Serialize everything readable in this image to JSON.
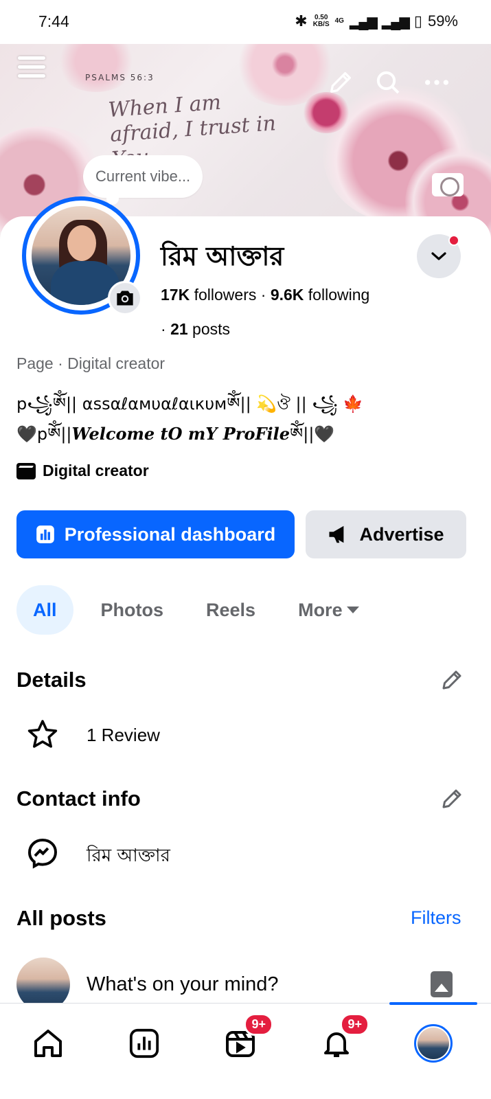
{
  "status": {
    "time": "7:44",
    "speed_value": "0.50",
    "speed_unit": "KB/S",
    "network": "4G",
    "battery": "59%"
  },
  "cover": {
    "verse": "PSALMS 56:3",
    "quote": "When I am afraid, I trust in You"
  },
  "vibe": {
    "label": "Current vibe..."
  },
  "profile": {
    "name": "রিম আক্তার",
    "followers_count": "17K",
    "followers_label": "followers",
    "following_count": "9.6K",
    "following_label": "following",
    "posts_count": "21",
    "posts_label": "posts",
    "page_category": "Page · Digital creator",
    "bio_line1": "p꧁ༀ|| αѕѕαℓαмυαℓαιкυмༀ|| 💫ঔ || ꧁ 🍁",
    "bio_line2_prefix": "🖤pༀ||",
    "bio_line2_styled": "Welcome tO mY ProFile",
    "bio_line2_suffix": "ༀ||🖤",
    "creator_label": "Digital creator"
  },
  "actions": {
    "dashboard_label": "Professional dashboard",
    "advertise_label": "Advertise"
  },
  "tabs": [
    {
      "label": "All"
    },
    {
      "label": "Photos"
    },
    {
      "label": "Reels"
    },
    {
      "label": "More"
    }
  ],
  "details": {
    "title": "Details",
    "review_label": "1 Review"
  },
  "contact": {
    "title": "Contact info",
    "messenger_name": "রিম আক্তার"
  },
  "posts": {
    "title": "All posts",
    "filters_label": "Filters",
    "composer_placeholder": "What's on your mind?"
  },
  "bottom_nav": {
    "video_badge": "9+",
    "notifications_badge": "9+"
  },
  "colors": {
    "accent": "#0866ff",
    "badge": "#e41e3f",
    "secondary_text": "#65676b"
  }
}
